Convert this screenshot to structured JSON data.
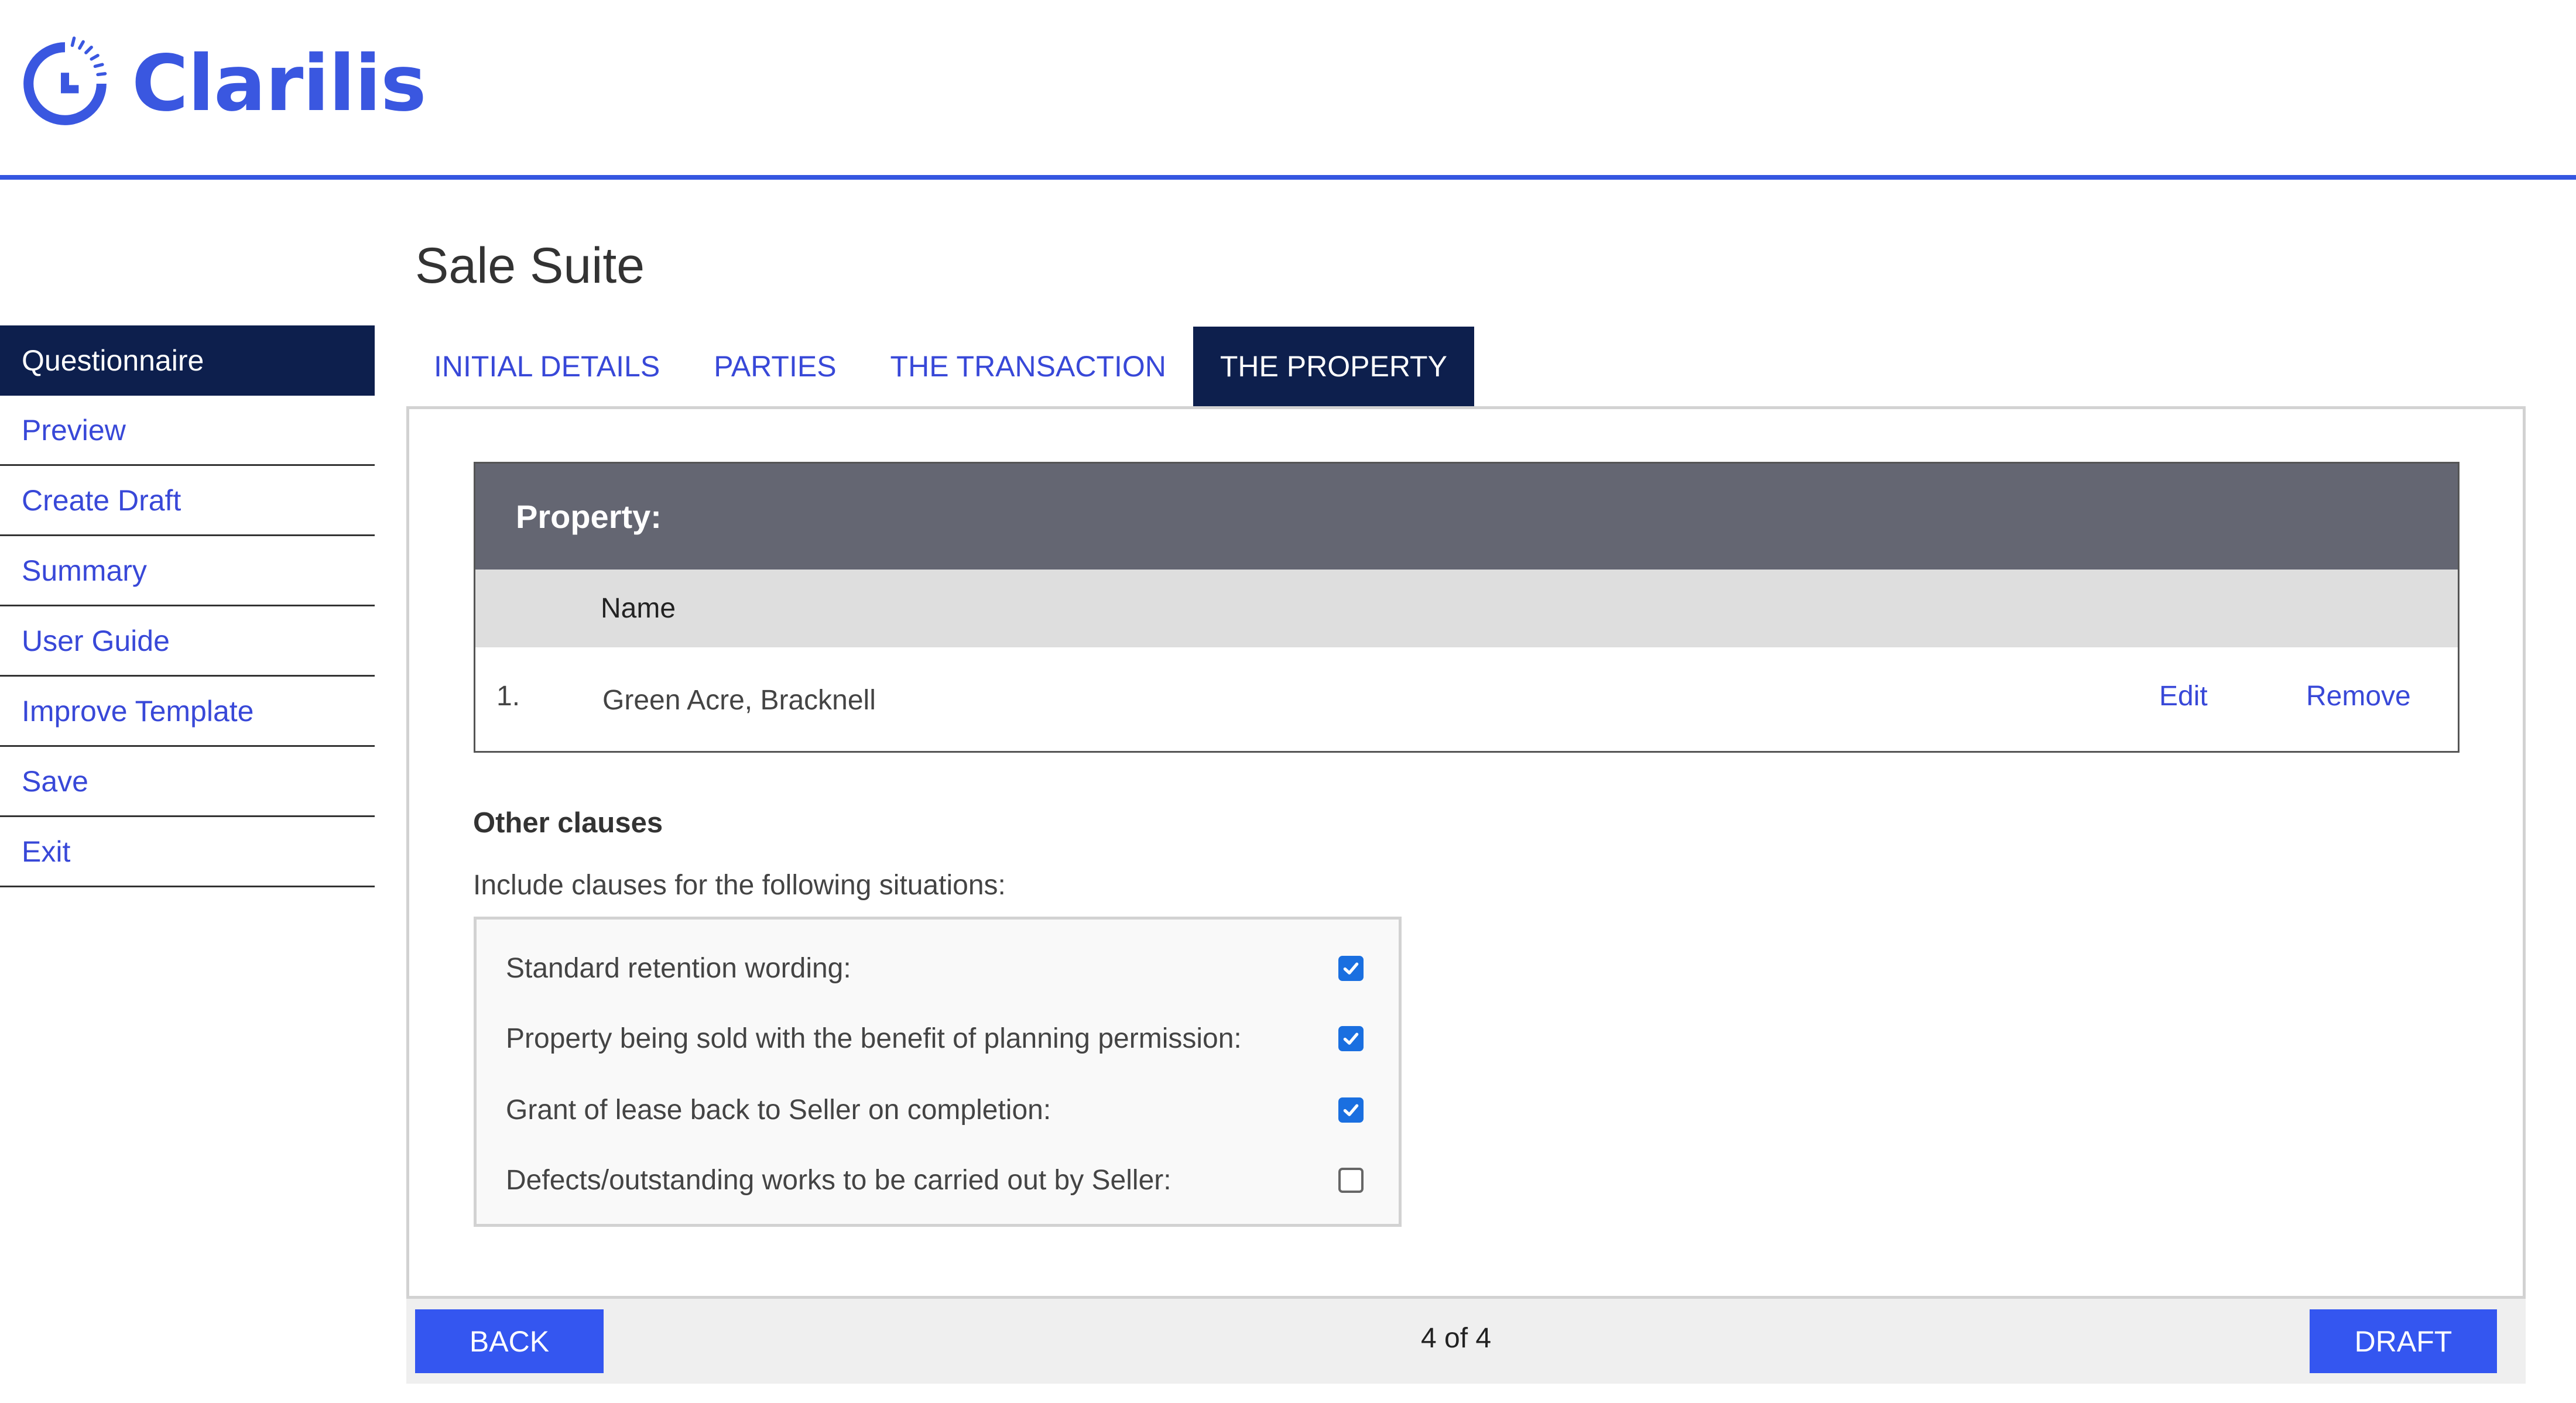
{
  "app": {
    "logo_text": "Clarilis",
    "brand_color": "#3a57e0",
    "accent_dark": "#0d1f4d"
  },
  "page": {
    "title": "Sale Suite"
  },
  "sidebar": {
    "items": [
      {
        "label": "Questionnaire",
        "active": true
      },
      {
        "label": "Preview"
      },
      {
        "label": "Create Draft"
      },
      {
        "label": "Summary"
      },
      {
        "label": "User Guide"
      },
      {
        "label": "Improve Template"
      },
      {
        "label": "Save"
      },
      {
        "label": "Exit"
      }
    ]
  },
  "tabs": [
    {
      "label": "INITIAL DETAILS"
    },
    {
      "label": "PARTIES"
    },
    {
      "label": "THE TRANSACTION"
    },
    {
      "label": "THE PROPERTY",
      "active": true
    }
  ],
  "property_table": {
    "heading": "Property:",
    "column_header": "Name",
    "rows": [
      {
        "number": "1.",
        "name": "Green Acre, Bracknell",
        "edit_label": "Edit",
        "remove_label": "Remove"
      }
    ]
  },
  "other_clauses": {
    "title": "Other clauses",
    "subtitle": "Include clauses for the following situations:",
    "items": [
      {
        "label": "Standard retention wording:",
        "checked": true
      },
      {
        "label": "Property being sold with the benefit of planning permission:",
        "checked": true
      },
      {
        "label": "Grant of lease back to Seller on completion:",
        "checked": true
      },
      {
        "label": "Defects/outstanding works to be carried out by Seller:",
        "checked": false
      }
    ]
  },
  "footer": {
    "back_label": "BACK",
    "page_indicator": "4 of 4",
    "draft_label": "DRAFT"
  }
}
